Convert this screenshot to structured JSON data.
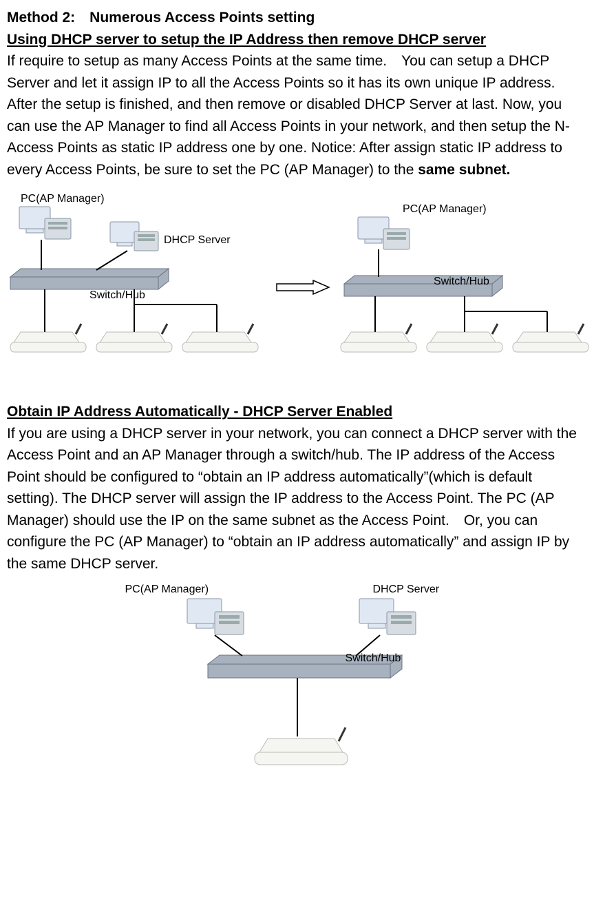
{
  "method2": {
    "title": "Method 2: Numerous Access Points setting",
    "subtitle": "Using DHCP server to setup the IP Address then remove DHCP server",
    "body_pre": "If require to setup as many Access Points at the same time. You can setup a DHCP Server and let it assign IP to all the Access Points so it has its own unique IP address. After the setup is finished, and then remove or disabled DHCP Server at last. Now, you can use the AP Manager to find all Access Points in your network, and then setup the N-Access Points as static IP address one by one. Notice: After assign static IP address to every Access Points, be sure to set the PC (AP Manager) to the ",
    "body_bold": "same subnet."
  },
  "diagramA": {
    "pc_label": "PC(AP Manager)",
    "dhcp_label": "DHCP Server",
    "switch_label": "Switch/Hub"
  },
  "diagramB": {
    "pc_label": "PC(AP Manager)",
    "switch_label": "Switch/Hub"
  },
  "section2": {
    "title": "Obtain IP Address Automatically - DHCP Server Enabled",
    "body": "If you are using a DHCP server in your network, you can connect a DHCP server with the Access Point and an AP Manager through a switch/hub. The IP address of the Access Point should be configured to “obtain an IP address automatically”(which is default setting). The DHCP server will assign the IP address to the Access Point. The PC (AP Manager) should use the IP on the same subnet as the Access Point. Or, you can configure the PC (AP Manager) to “obtain an IP address automatically” and assign IP by the same DHCP server."
  },
  "diagramC": {
    "pc_label": "PC(AP Manager)",
    "dhcp_label": "DHCP Server",
    "switch_label": "Switch/Hub"
  }
}
